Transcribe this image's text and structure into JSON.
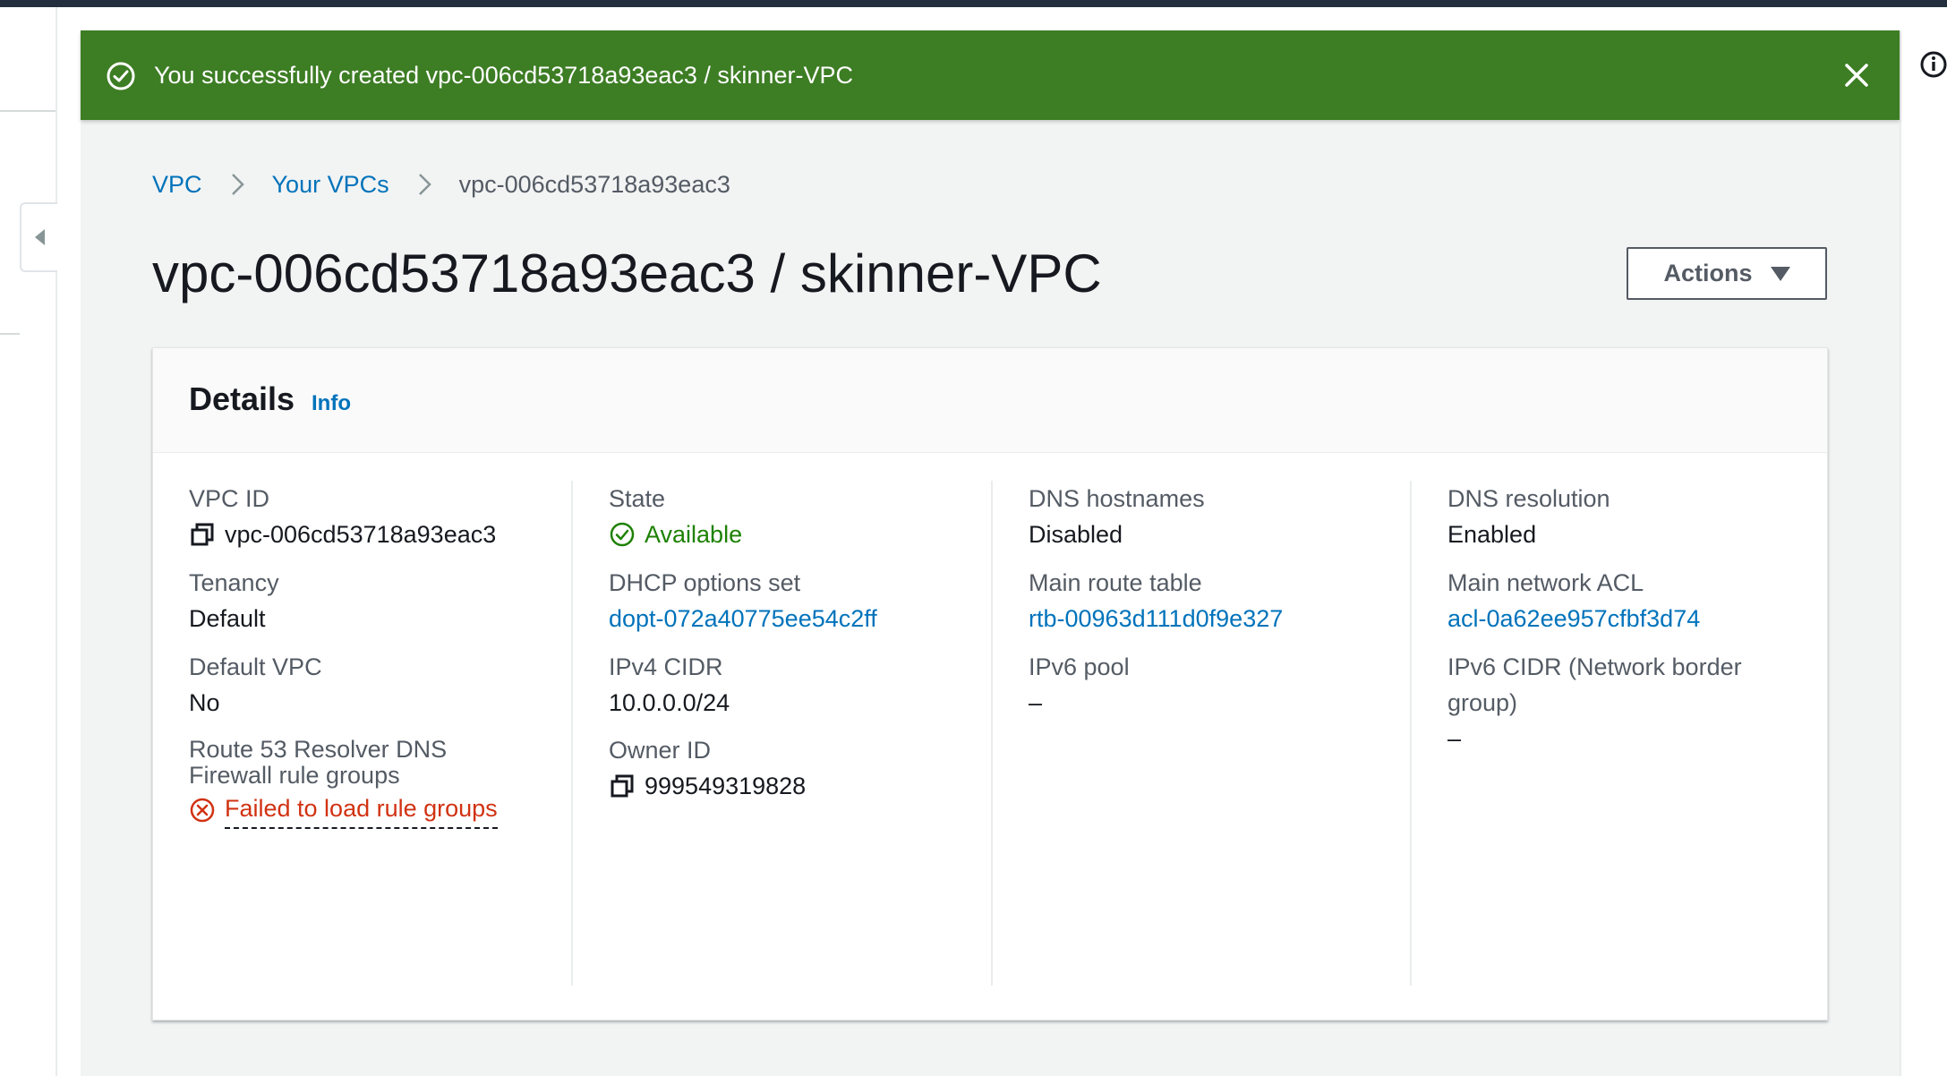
{
  "flash": {
    "message": "You successfully created vpc-006cd53718a93eac3 / skinner-VPC"
  },
  "breadcrumb": {
    "items": [
      "VPC",
      "Your VPCs"
    ],
    "current": "vpc-006cd53718a93eac3"
  },
  "page": {
    "title": "vpc-006cd53718a93eac3 / skinner-VPC",
    "actions_label": "Actions"
  },
  "details": {
    "title": "Details",
    "info_label": "Info",
    "vpc_id": {
      "label": "VPC ID",
      "value": "vpc-006cd53718a93eac3"
    },
    "tenancy": {
      "label": "Tenancy",
      "value": "Default"
    },
    "default_vpc": {
      "label": "Default VPC",
      "value": "No"
    },
    "route53": {
      "label": "Route 53 Resolver DNS Firewall rule groups",
      "value": "Failed to load rule groups"
    },
    "state": {
      "label": "State",
      "value": "Available"
    },
    "dhcp": {
      "label": "DHCP options set",
      "value": "dopt-072a40775ee54c2ff"
    },
    "ipv4": {
      "label": "IPv4 CIDR",
      "value": "10.0.0.0/24"
    },
    "owner": {
      "label": "Owner ID",
      "value": "999549319828"
    },
    "dns_hostnames": {
      "label": "DNS hostnames",
      "value": "Disabled"
    },
    "main_route": {
      "label": "Main route table",
      "value": "rtb-00963d111d0f9e327"
    },
    "ipv6_pool": {
      "label": "IPv6 pool",
      "value": "–"
    },
    "dns_resolution": {
      "label": "DNS resolution",
      "value": "Enabled"
    },
    "main_acl": {
      "label": "Main network ACL",
      "value": "acl-0a62ee957cfbf3d74"
    },
    "ipv6_cidr": {
      "label": "IPv6 CIDR (Network border group)",
      "value": "–"
    }
  },
  "icons": {
    "flash": "check-circle-icon",
    "close": "close-icon",
    "help": "info-circle-icon",
    "copy": "copy-icon",
    "state": "check-circle-icon",
    "error": "error-circle-icon"
  },
  "colors": {
    "success_banner": "#3d7d24",
    "link": "#0073bb",
    "success_text": "#1d8102",
    "error_text": "#d13212"
  }
}
